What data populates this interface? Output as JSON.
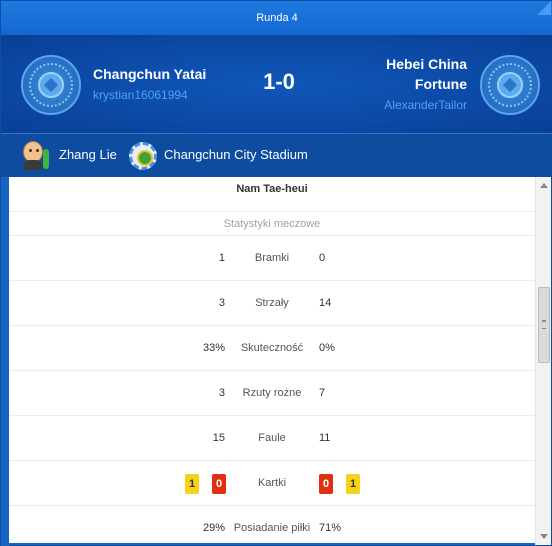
{
  "round": {
    "label": "Runda 4"
  },
  "home": {
    "name": "Changchun Yatai",
    "user": "krystian16061994",
    "badge_icon": "team-crest-icon"
  },
  "away": {
    "name_line1": "Hebei China",
    "name_line2": "Fortune",
    "user": "AlexanderTailor",
    "badge_icon": "team-crest-icon"
  },
  "score": "1-0",
  "info": {
    "referee": "Zhang Lie",
    "stadium": "Changchun City Stadium"
  },
  "scorer": "Nam Tae-heui",
  "stats_title": "Statystyki meczowe",
  "stats": [
    {
      "label": "Bramki",
      "home": "1",
      "away": "0"
    },
    {
      "label": "Strzały",
      "home": "3",
      "away": "14"
    },
    {
      "label": "Skuteczność",
      "home": "33%",
      "away": "0%"
    },
    {
      "label": "Rzuty rożne",
      "home": "3",
      "away": "7"
    },
    {
      "label": "Faule",
      "home": "15",
      "away": "11"
    }
  ],
  "cards": {
    "label": "Kartki",
    "home_yellow": "1",
    "home_red": "0",
    "away_red": "0",
    "away_yellow": "1"
  },
  "possession": {
    "label": "Posiadanie piłki",
    "home": "29%",
    "away": "71%"
  },
  "colors": {
    "header_blue": "#0b46a1",
    "accent_link": "#4da3f5",
    "yellow_card": "#f6d21a",
    "red_card": "#e02f12"
  }
}
